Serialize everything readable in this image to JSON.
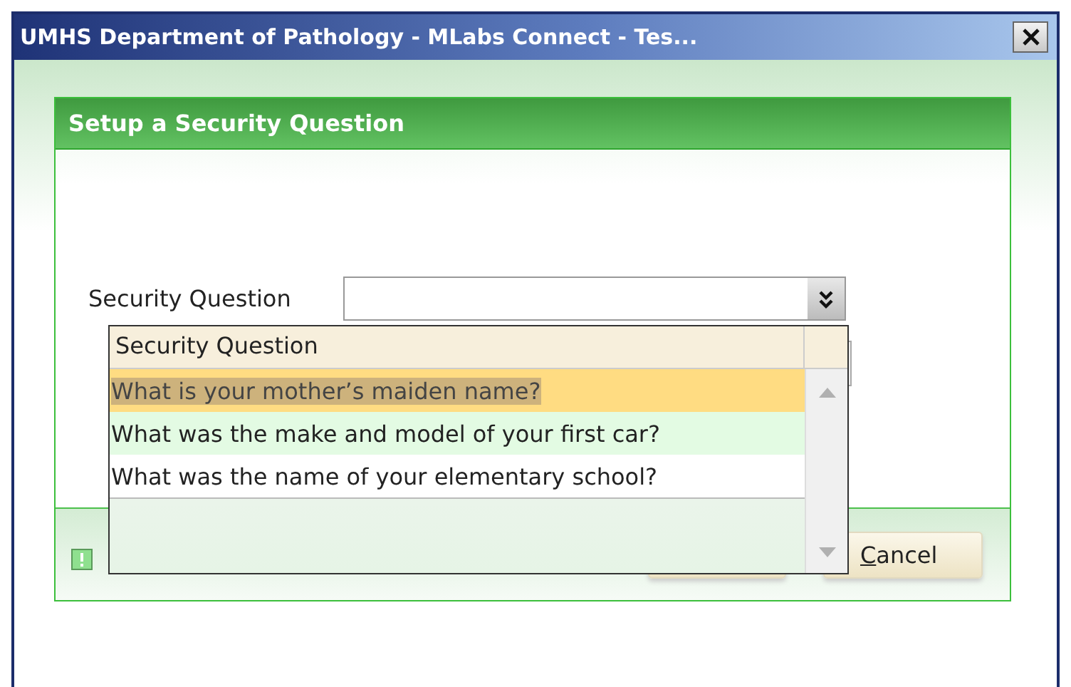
{
  "window": {
    "title": "UMHS Department of Pathology - MLabs Connect - Tes..."
  },
  "dialog": {
    "title": "Setup a Security Question",
    "field_label": "Security Question"
  },
  "dropdown": {
    "expanded": true,
    "header": "Security Question",
    "options": [
      {
        "label": "What is your mother’s maiden name?",
        "selected": true,
        "hovered": false
      },
      {
        "label": "What was the make and model of your first car?",
        "selected": false,
        "hovered": true
      },
      {
        "label": "What was the name of your elementary school?",
        "selected": false,
        "hovered": false
      }
    ]
  },
  "buttons": [
    {
      "kind": "covered"
    },
    {
      "kind": "text",
      "label": "Cancel",
      "mnemonic_underlined": true
    }
  ]
}
